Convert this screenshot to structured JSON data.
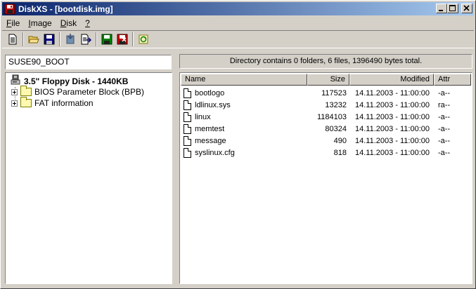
{
  "window": {
    "title": "DiskXS - [bootdisk.img]"
  },
  "menu": [
    {
      "label": "File",
      "accel": "F",
      "rest": "ile"
    },
    {
      "label": "Image",
      "accel": "I",
      "rest": "mage"
    },
    {
      "label": "Disk",
      "accel": "D",
      "rest": "isk"
    },
    {
      "label": "?",
      "accel": "?",
      "rest": ""
    }
  ],
  "toolbar": {
    "icons": [
      "new-icon",
      "open-icon",
      "save-icon",
      "import-icon",
      "export-icon",
      "write-disk-icon",
      "read-disk-icon",
      "refresh-icon"
    ]
  },
  "volume": {
    "label": "SUSE90_BOOT"
  },
  "summary": "Directory contains 0 folders, 6 files, 1396490 bytes total.",
  "tree": {
    "root": "3.5\" Floppy Disk - 1440KB",
    "nodes": [
      "BIOS Parameter Block (BPB)",
      "FAT information"
    ]
  },
  "list": {
    "columns": {
      "name": "Name",
      "size": "Size",
      "modified": "Modified",
      "attr": "Attr"
    },
    "files": [
      {
        "name": "bootlogo",
        "size": "117523",
        "modified": "14.11.2003 - 11:00:00",
        "attr": "-a--"
      },
      {
        "name": "ldlinux.sys",
        "size": "13232",
        "modified": "14.11.2003 - 11:00:00",
        "attr": "ra--"
      },
      {
        "name": "linux",
        "size": "1184103",
        "modified": "14.11.2003 - 11:00:00",
        "attr": "-a--"
      },
      {
        "name": "memtest",
        "size": "80324",
        "modified": "14.11.2003 - 11:00:00",
        "attr": "-a--"
      },
      {
        "name": "message",
        "size": "490",
        "modified": "14.11.2003 - 11:00:00",
        "attr": "-a--"
      },
      {
        "name": "syslinux.cfg",
        "size": "818",
        "modified": "14.11.2003 - 11:00:00",
        "attr": "-a--"
      }
    ]
  },
  "colors": {
    "titlebar_start": "#0a246a",
    "titlebar_end": "#a6caf0",
    "face": "#d4d0c8"
  }
}
